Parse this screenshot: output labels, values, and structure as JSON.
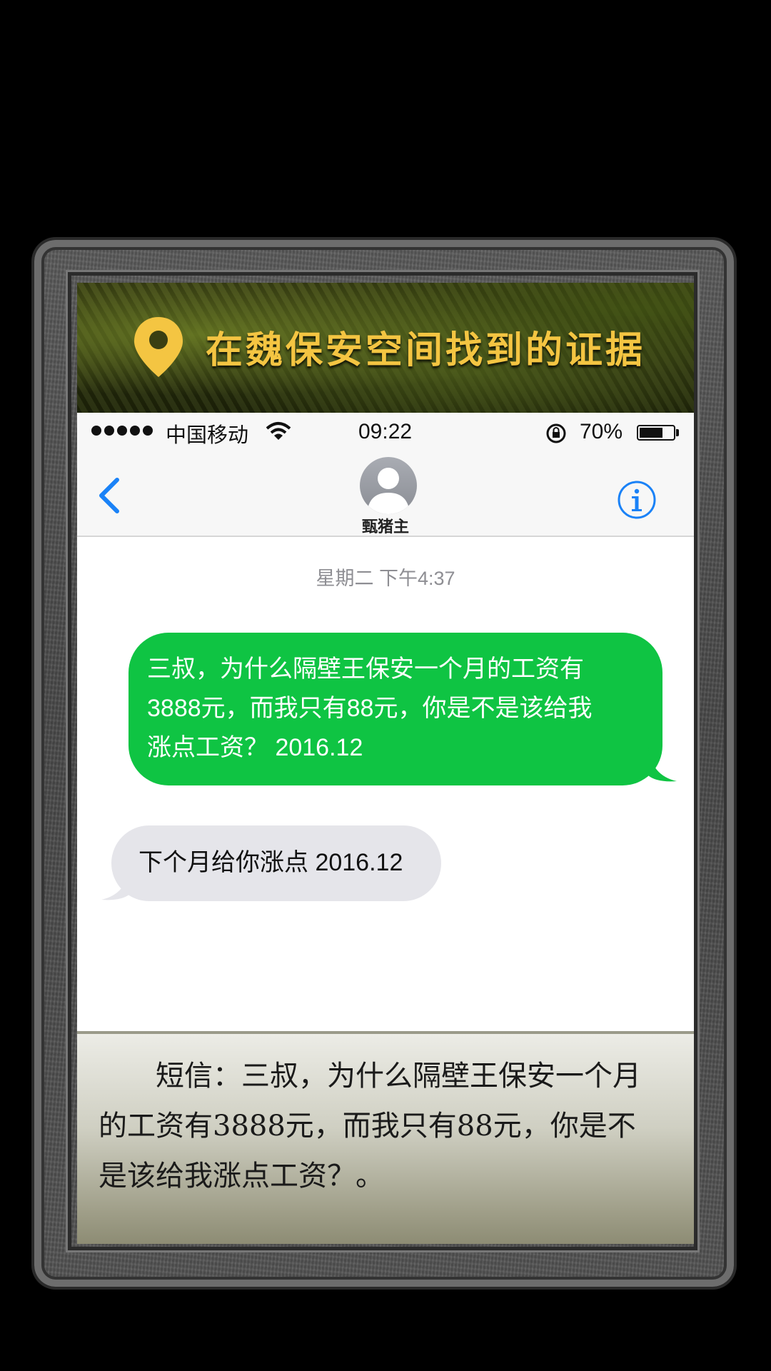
{
  "banner": {
    "title": "在魏保安空间找到的证据",
    "icon": "location-pin-icon",
    "title_color": "#f4c542"
  },
  "status_bar": {
    "carrier": "中国移动",
    "time": "09:22",
    "battery_percent": "70%",
    "battery_level": 0.7
  },
  "nav": {
    "contact_name": "甄猪主"
  },
  "conversation": {
    "timestamp": "星期二 下午4:37",
    "messages": [
      {
        "direction": "outgoing",
        "lines": [
          "三叔，为什么隔壁王保安一个月的工资有",
          "3888元，而我只有88元，你是不是该给我",
          "涨点工资？ 2016.12"
        ]
      },
      {
        "direction": "incoming",
        "lines": [
          "下个月给你涨点 2016.12"
        ]
      }
    ],
    "outgoing_color": "#0fc443",
    "incoming_color": "#e5e5ea"
  },
  "caption": {
    "lines": [
      "短信：三叔，为什么隔壁王保安一个月",
      "的工资有3888元，而我只有88元，你是不",
      "是该给我涨点工资？。"
    ]
  }
}
